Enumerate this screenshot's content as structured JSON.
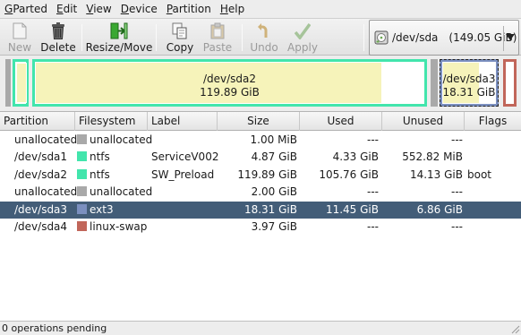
{
  "menu": [
    {
      "mnemonic": "G",
      "rest": "Parted"
    },
    {
      "mnemonic": "E",
      "rest": "dit"
    },
    {
      "mnemonic": "V",
      "rest": "iew"
    },
    {
      "mnemonic": "D",
      "rest": "evice"
    },
    {
      "mnemonic": "P",
      "rest": "artition"
    },
    {
      "mnemonic": "H",
      "rest": "elp"
    }
  ],
  "toolbar": {
    "new_label": "New",
    "delete_label": "Delete",
    "resize_label": "Resize/Move",
    "copy_label": "Copy",
    "paste_label": "Paste",
    "undo_label": "Undo",
    "apply_label": "Apply",
    "device_name": "/dev/sda",
    "device_size": "(149.05 GiB)"
  },
  "diskmap": {
    "sda2_name": "/dev/sda2",
    "sda2_size": "119.89 GiB",
    "sda3_name": "/dev/sda3",
    "sda3_size": "18.31 GiB"
  },
  "columns": [
    "Partition",
    "Filesystem",
    "Label",
    "Size",
    "Used",
    "Unused",
    "Flags"
  ],
  "rows": [
    {
      "partition": "unallocated",
      "filesystem": "unallocated",
      "label": "",
      "size": "1.00 MiB",
      "used": "---",
      "unused": "---",
      "flags": ""
    },
    {
      "partition": "/dev/sda1",
      "filesystem": "ntfs",
      "label": "ServiceV002",
      "size": "4.87 GiB",
      "used": "4.33 GiB",
      "unused": "552.82 MiB",
      "flags": ""
    },
    {
      "partition": "/dev/sda2",
      "filesystem": "ntfs",
      "label": "SW_Preload",
      "size": "119.89 GiB",
      "used": "105.76 GiB",
      "unused": "14.13 GiB",
      "flags": "boot"
    },
    {
      "partition": "unallocated",
      "filesystem": "unallocated",
      "label": "",
      "size": "2.00 GiB",
      "used": "---",
      "unused": "---",
      "flags": ""
    },
    {
      "partition": "/dev/sda3",
      "filesystem": "ext3",
      "label": "",
      "size": "18.31 GiB",
      "used": "11.45 GiB",
      "unused": "6.86 GiB",
      "flags": ""
    },
    {
      "partition": "/dev/sda4",
      "filesystem": "linux-swap",
      "label": "",
      "size": "3.97 GiB",
      "used": "---",
      "unused": "---",
      "flags": ""
    }
  ],
  "selected_row": 4,
  "colors": {
    "unallocated": "#a9a9a9",
    "ntfs": "#42e5ac",
    "ext3": "#7b8fbf",
    "linux-swap": "#c1665a",
    "selection": "#435d78"
  },
  "status": "0 operations pending"
}
